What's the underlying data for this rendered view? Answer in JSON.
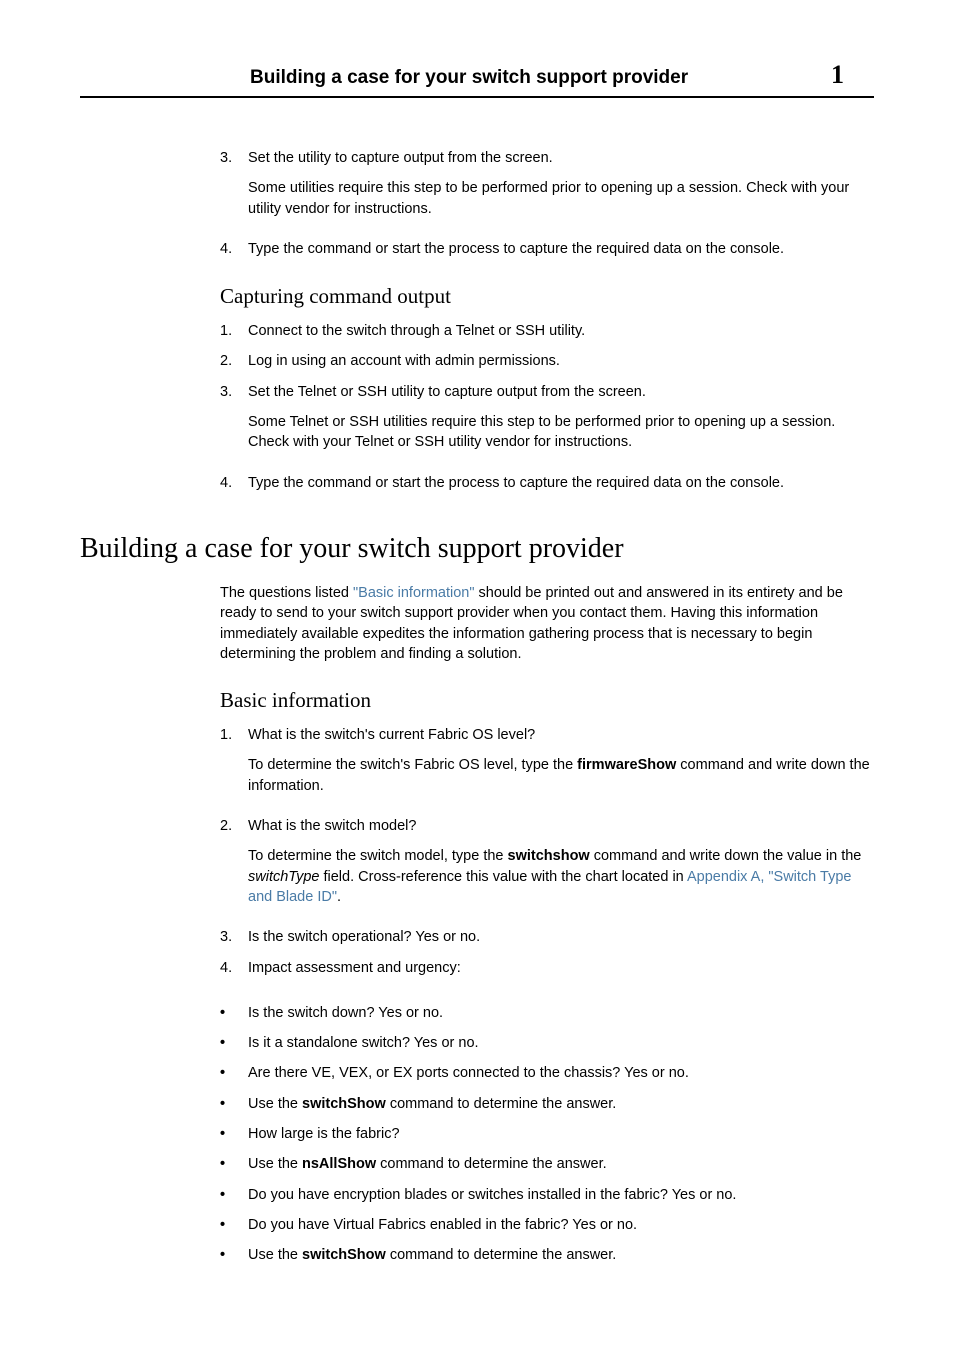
{
  "header": {
    "title": "Building a case for your switch support provider",
    "chapter": "1"
  },
  "top_list": {
    "item3_num": "3.",
    "item3_txt": "Set the utility to capture output from the screen.",
    "item3_sub": "Some utilities require this step to be performed prior to opening up a session. Check with your utility vendor for instructions.",
    "item4_num": "4.",
    "item4_txt": "Type the command or start the process to capture the required data on the console."
  },
  "capture": {
    "heading": "Capturing command output",
    "i1_num": "1.",
    "i1_txt": "Connect to the switch through a Telnet or SSH utility.",
    "i2_num": "2.",
    "i2_txt": "Log in using an account with admin permissions.",
    "i3_num": "3.",
    "i3_txt": "Set the Telnet or SSH utility to capture output from the screen.",
    "i3_sub": "Some Telnet or SSH utilities require this step to be performed prior to opening up a session. Check with your Telnet or SSH utility vendor for instructions.",
    "i4_num": "4.",
    "i4_txt": "Type the command or start the process to capture the required data on the console."
  },
  "building": {
    "heading": "Building a case for your switch support provider",
    "intro_pre": "The questions listed ",
    "intro_link": "\"Basic information\"",
    "intro_post": " should be printed out and answered in its entirety and be ready to send to your switch support provider when you contact them. Having this information immediately available expedites the information gathering process that is necessary to begin determining the problem and finding a solution."
  },
  "basic": {
    "heading": "Basic information",
    "i1_num": "1.",
    "i1_txt": "What is the switch's current Fabric OS level?",
    "i1_sub_pre": "To determine the switch's Fabric OS level, type the ",
    "i1_sub_cmd": "firmwareShow",
    "i1_sub_post": " command and write down the information.",
    "i2_num": "2.",
    "i2_txt": "What is the switch model?",
    "i2_sub_pre": "To determine the switch model, type the ",
    "i2_sub_cmd": "switchshow",
    "i2_sub_post1": " command and write down the value in the ",
    "i2_sub_italic": "switchType",
    "i2_sub_post2": " field. Cross-reference this value with the chart located in ",
    "i2_sub_link": "Appendix A, \"Switch Type and Blade ID\"",
    "i2_sub_post3": ".",
    "i3_num": "3.",
    "i3_txt": "Is the switch operational? Yes or no.",
    "i4_num": "4.",
    "i4_txt": "Impact assessment and urgency:",
    "b1": "Is the switch down? Yes or no.",
    "b2": "Is it a standalone switch? Yes or no.",
    "b3": "Are there VE, VEX, or EX ports connected to the chassis? Yes or no.",
    "b4_pre": "Use the ",
    "b4_cmd": "switchShow",
    "b4_post": " command to determine the answer.",
    "b5": "How large is the fabric?",
    "b6_pre": "Use the ",
    "b6_cmd": "nsAllShow",
    "b6_post": " command to determine the answer.",
    "b7": "Do you have encryption blades or switches installed in the fabric? Yes or no.",
    "b8": "Do you have Virtual Fabrics enabled in the fabric? Yes or no.",
    "b9_pre": "Use the ",
    "b9_cmd": "switchShow",
    "b9_post": " command to determine the answer."
  }
}
